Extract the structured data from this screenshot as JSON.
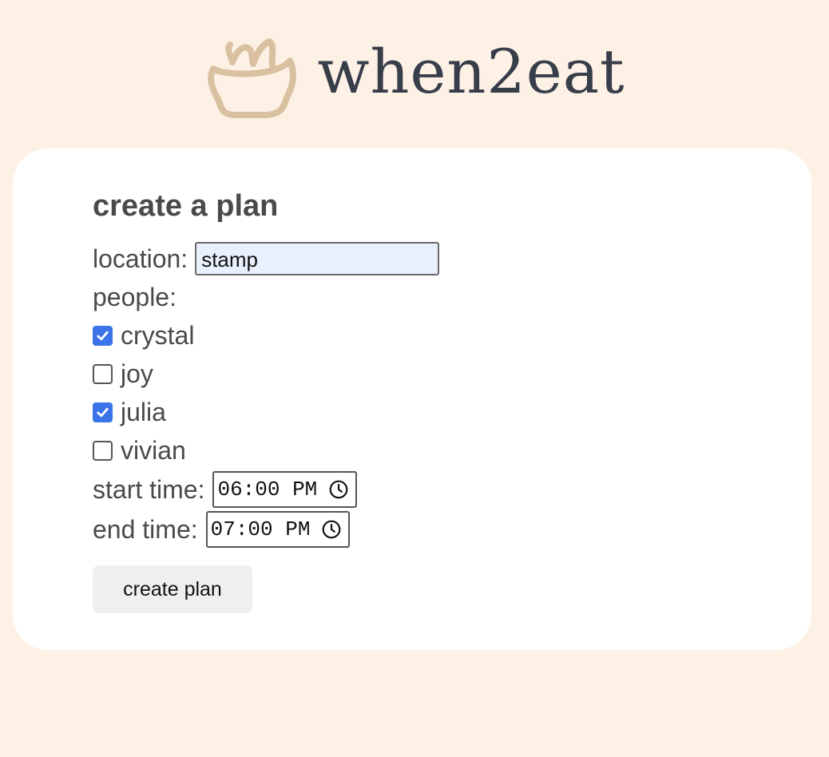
{
  "header": {
    "brand": "when2eat",
    "logo_icon": "bowl-icon",
    "logo_color": "#d9c0a0"
  },
  "form": {
    "title": "create a plan",
    "location_label": "location:",
    "location_value": "stamp",
    "people_label": "people:",
    "people": [
      {
        "name": "crystal",
        "checked": true
      },
      {
        "name": "joy",
        "checked": false
      },
      {
        "name": "julia",
        "checked": true
      },
      {
        "name": "vivian",
        "checked": false
      }
    ],
    "start_label": "start time:",
    "start_value": "06:00 PM",
    "end_label": "end time:",
    "end_value": "07:00 PM",
    "submit_label": "create plan"
  },
  "colors": {
    "background": "#fdf1e6",
    "card": "#ffffff",
    "checkbox_accent": "#3a74e8",
    "input_autofill": "#e8f0fe"
  }
}
